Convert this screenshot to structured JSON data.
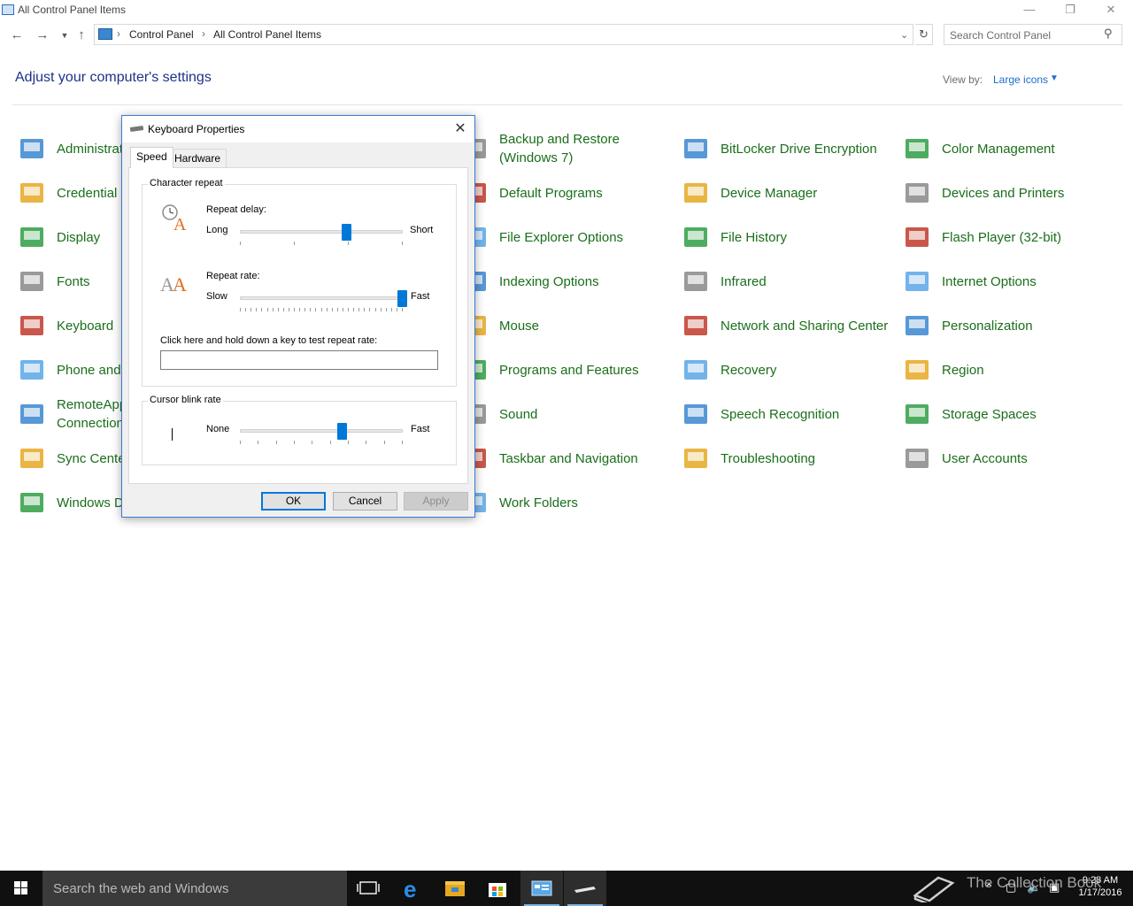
{
  "window": {
    "title": "All Control Panel Items"
  },
  "address_bar": {
    "crumbs": [
      "Control Panel",
      "All Control Panel Items"
    ],
    "search_placeholder": "Search Control Panel"
  },
  "header": {
    "heading": "Adjust your computer's settings",
    "view_by_label": "View by:",
    "view_by_value": "Large icons"
  },
  "items": [
    {
      "label": "Administrative Tools",
      "icon": "admin-tools-icon"
    },
    {
      "label": "Credential Manager",
      "icon": "credential-manager-icon"
    },
    {
      "label": "Display",
      "icon": "display-icon"
    },
    {
      "label": "Fonts",
      "icon": "fonts-icon"
    },
    {
      "label": "Keyboard",
      "icon": "keyboard-icon"
    },
    {
      "label": "Phone and Modem",
      "icon": "phone-modem-icon"
    },
    {
      "label": "RemoteApp and Desktop Connections",
      "icon": "remoteapp-icon"
    },
    {
      "label": "Sync Center",
      "icon": "sync-center-icon"
    },
    {
      "label": "Windows Defender",
      "icon": "windows-firewall-icon"
    },
    {
      "label": "Backup and Restore (Windows 7)",
      "icon": "backup-restore-icon"
    },
    {
      "label": "Default Programs",
      "icon": "default-programs-icon"
    },
    {
      "label": "File Explorer Options",
      "icon": "file-explorer-options-icon"
    },
    {
      "label": "Indexing Options",
      "icon": "indexing-options-icon"
    },
    {
      "label": "Mouse",
      "icon": "mouse-icon"
    },
    {
      "label": "Programs and Features",
      "icon": "programs-features-icon"
    },
    {
      "label": "Sound",
      "icon": "sound-icon"
    },
    {
      "label": "Taskbar and Navigation",
      "icon": "taskbar-icon"
    },
    {
      "label": "Work Folders",
      "icon": "work-folders-icon"
    },
    {
      "label": "BitLocker Drive Encryption",
      "icon": "bitlocker-icon"
    },
    {
      "label": "Device Manager",
      "icon": "device-manager-icon"
    },
    {
      "label": "File History",
      "icon": "file-history-icon"
    },
    {
      "label": "Infrared",
      "icon": "infrared-icon"
    },
    {
      "label": "Network and Sharing Center",
      "icon": "network-sharing-icon"
    },
    {
      "label": "Recovery",
      "icon": "recovery-icon"
    },
    {
      "label": "Speech Recognition",
      "icon": "speech-recognition-icon"
    },
    {
      "label": "Troubleshooting",
      "icon": "troubleshooting-icon"
    },
    {
      "label": "Color Management",
      "icon": "color-management-icon"
    },
    {
      "label": "Devices and Printers",
      "icon": "devices-printers-icon"
    },
    {
      "label": "Flash Player (32-bit)",
      "icon": "flash-player-icon"
    },
    {
      "label": "Internet Options",
      "icon": "internet-options-icon"
    },
    {
      "label": "Personalization",
      "icon": "personalization-icon"
    },
    {
      "label": "Region",
      "icon": "region-icon"
    },
    {
      "label": "Storage Spaces",
      "icon": "storage-spaces-icon"
    },
    {
      "label": "User Accounts",
      "icon": "user-accounts-icon"
    }
  ],
  "dialog": {
    "title": "Keyboard Properties",
    "tabs": [
      "Speed",
      "Hardware"
    ],
    "character_repeat": {
      "group_title": "Character repeat",
      "repeat_delay": {
        "label": "Repeat delay:",
        "min_label": "Long",
        "max_label": "Short",
        "value_fraction": 0.66
      },
      "repeat_rate": {
        "label": "Repeat rate:",
        "min_label": "Slow",
        "max_label": "Fast",
        "value_fraction": 1.0
      },
      "test_label": "Click here and hold down a key to test repeat rate:",
      "test_value": ""
    },
    "cursor_blink": {
      "group_title": "Cursor blink rate",
      "min_label": "None",
      "max_label": "Fast",
      "value_fraction": 0.63
    },
    "buttons": {
      "ok": "OK",
      "cancel": "Cancel",
      "apply": "Apply"
    }
  },
  "taskbar": {
    "search_placeholder": "Search the web and Windows",
    "time": "9:28 AM",
    "date": "1/17/2016"
  },
  "watermark": "The Collection Book",
  "colors": {
    "item_text": "#1a6e1a",
    "heading": "#1e3287",
    "link": "#1e6ec8",
    "accent": "#0078d7",
    "taskbar": "#101010"
  }
}
